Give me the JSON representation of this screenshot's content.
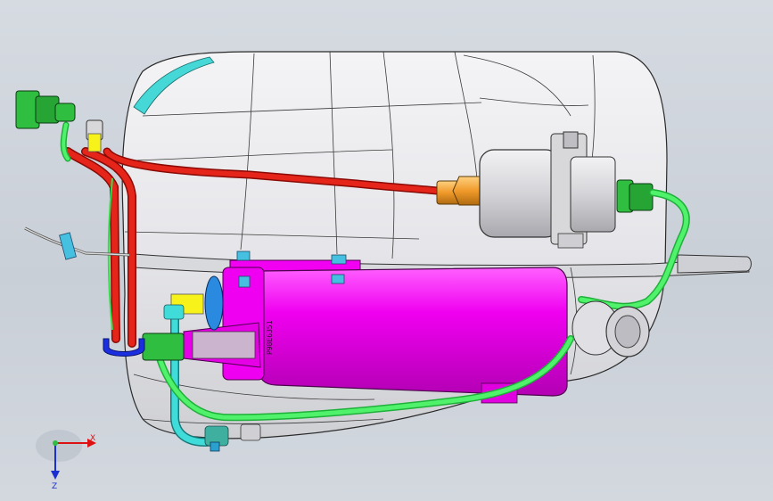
{
  "viewport": {
    "part_label": "P98E6351"
  },
  "triad": {
    "x_label": "X",
    "z_label": "Z"
  },
  "colors": {
    "background": "#d0d5dc",
    "tank": "#e9e9ec",
    "canister": "#ff00ff",
    "fuel_line_red": "#e21a12",
    "vapor_line_green": "#2fe04a",
    "coolant_line_cyan": "#3fd7d8",
    "filter_body": "#d9d9dc",
    "brass_fitting": "#f0a030",
    "yellow_port": "#f6f21a",
    "blue_clip": "#1b2fe0",
    "connector_green": "#2fae3a"
  },
  "icons": {
    "triad": "coordinate-triad-icon",
    "fuel_pump": "fuel-pump-icon"
  }
}
